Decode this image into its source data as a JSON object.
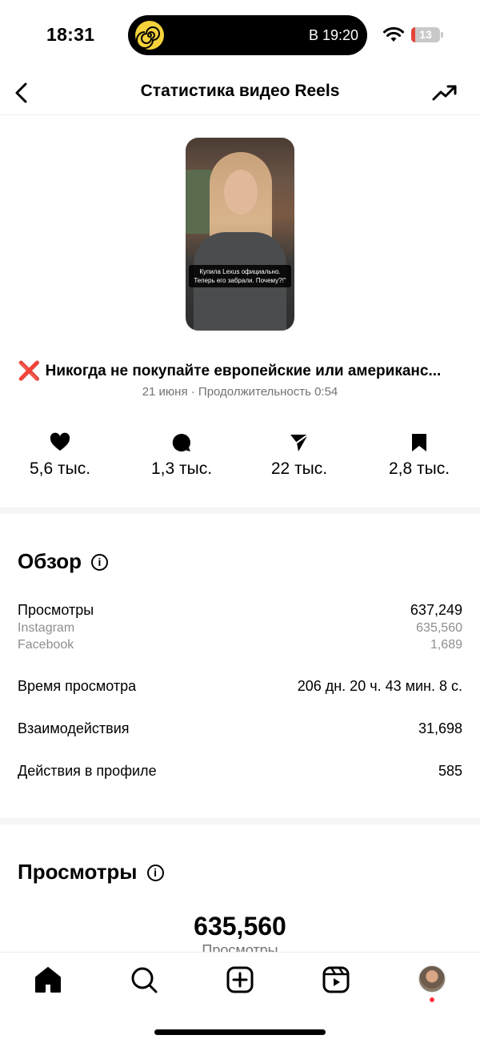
{
  "status_bar": {
    "time": "18:31",
    "island_text": "В 19:20",
    "battery": "13",
    "battery_level": 0.13
  },
  "header": {
    "title": "Статистика видео Reels"
  },
  "thumbnail": {
    "caption_line1": "Купила Lexus официально.",
    "caption_line2": "Теперь его забрали. Почему?!\""
  },
  "post": {
    "title_icon": "❌",
    "title": "Никогда не покупайте европейские или американс...",
    "meta": "21 июня · Продолжительность 0:54"
  },
  "engagement": {
    "likes": "5,6 тыс.",
    "comments": "1,3 тыс.",
    "shares": "22 тыс.",
    "saves": "2,8 тыс."
  },
  "overview": {
    "title": "Обзор",
    "info": "i",
    "views_label": "Просмотры",
    "views_value": "637,249",
    "instagram_label": "Instagram",
    "instagram_value": "635,560",
    "facebook_label": "Facebook",
    "facebook_value": "1,689",
    "watch_time_label": "Время просмотра",
    "watch_time_value": "206 дн. 20 ч. 43 мин. 8 с.",
    "interactions_label": "Взаимодействия",
    "interactions_value": "31,698",
    "profile_actions_label": "Действия в профиле",
    "profile_actions_value": "585"
  },
  "views_section": {
    "title": "Просмотры",
    "info": "i",
    "total": "635,560",
    "total_label": "Просмотры"
  },
  "icons": {
    "back": "chevron-left-icon",
    "trend": "trending-up-icon",
    "like": "heart-icon",
    "comment": "comment-icon",
    "share": "send-icon",
    "save": "bookmark-icon",
    "nav": [
      "home-icon",
      "search-icon",
      "create-icon",
      "reels-icon",
      "profile-avatar"
    ]
  },
  "colors": {
    "notification": "#ff3040",
    "error_x": "#e0262b",
    "battery_low": "#e5443a",
    "island_icon": "#f5d23b"
  }
}
